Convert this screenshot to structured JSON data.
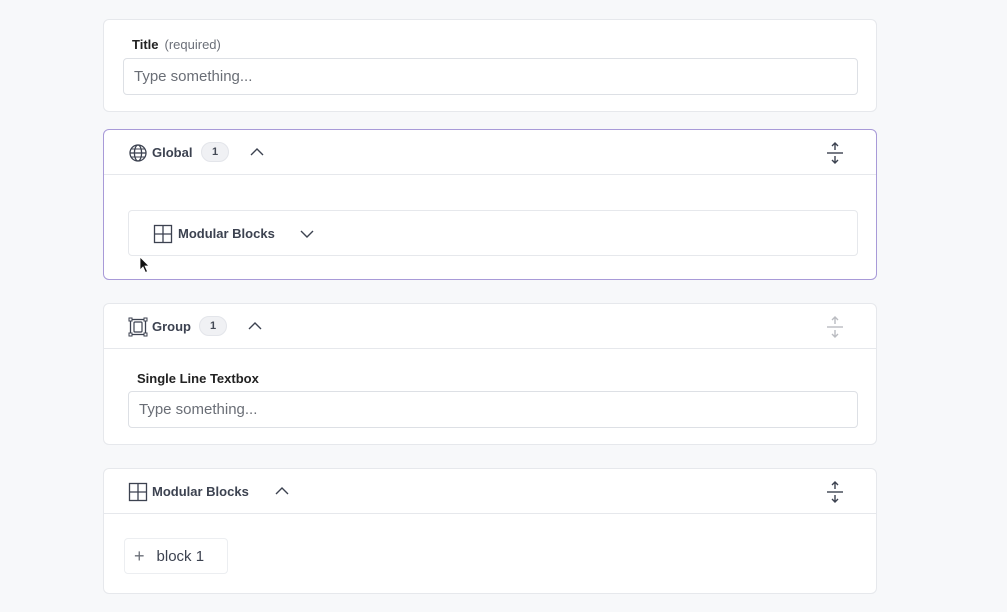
{
  "title_field": {
    "label": "Title",
    "hint": "(required)",
    "placeholder": "Type something..."
  },
  "global_section": {
    "title": "Global",
    "count": "1",
    "inner_block_title": "Modular Blocks"
  },
  "group_section": {
    "title": "Group",
    "count": "1",
    "field_label": "Single Line Textbox",
    "placeholder": "Type something..."
  },
  "modular_section": {
    "title": "Modular Blocks",
    "add_block_label": "block 1"
  },
  "colors": {
    "active_border": "#a89ad8",
    "card_border": "#e6e8ec",
    "background": "#f7f8fa"
  },
  "icons": {
    "global": "globe-icon",
    "group": "group-icon",
    "modular": "grid-icon",
    "expand": "expand-vertical-icon",
    "collapse": "chevron-up-icon",
    "dropdown": "chevron-down-icon",
    "add": "plus-icon"
  }
}
